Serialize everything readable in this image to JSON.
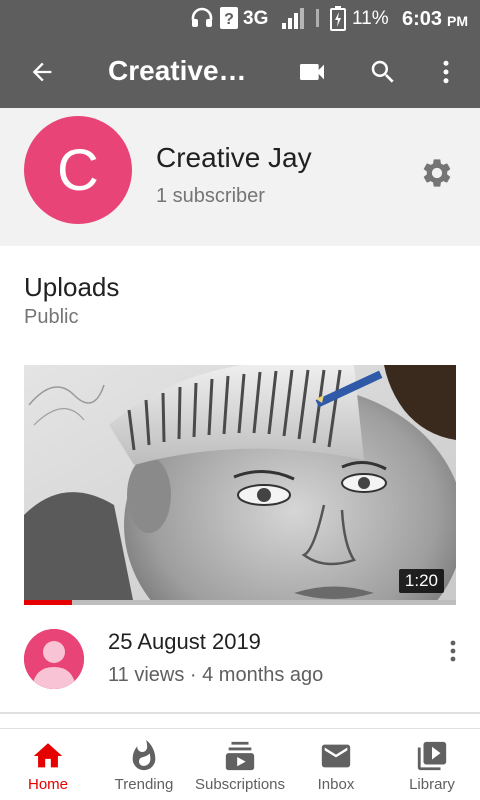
{
  "status_bar": {
    "network": "3G",
    "battery": "11%",
    "time": "6:03",
    "ampm": "PM"
  },
  "app_bar": {
    "title": "Creative…"
  },
  "channel": {
    "avatar_letter": "C",
    "name": "Creative Jay",
    "subscribers": "1 subscriber",
    "avatar_color": "#e84478"
  },
  "uploads": {
    "title": "Uploads",
    "visibility": "Public"
  },
  "video": {
    "duration": "1:20",
    "watched_fraction": 0.11,
    "title": "25 August 2019",
    "meta": "11 views · 4 months ago"
  },
  "bottom_nav": {
    "items": [
      {
        "label": "Home",
        "icon": "home-icon",
        "active": true
      },
      {
        "label": "Trending",
        "icon": "trending-icon",
        "active": false
      },
      {
        "label": "Subscriptions",
        "icon": "subscriptions-icon",
        "active": false
      },
      {
        "label": "Inbox",
        "icon": "inbox-icon",
        "active": false
      },
      {
        "label": "Library",
        "icon": "library-icon",
        "active": false
      }
    ]
  },
  "colors": {
    "app_bar": "#5e5e5e",
    "accent": "#e60000",
    "header_bg": "#f2f2f2"
  }
}
